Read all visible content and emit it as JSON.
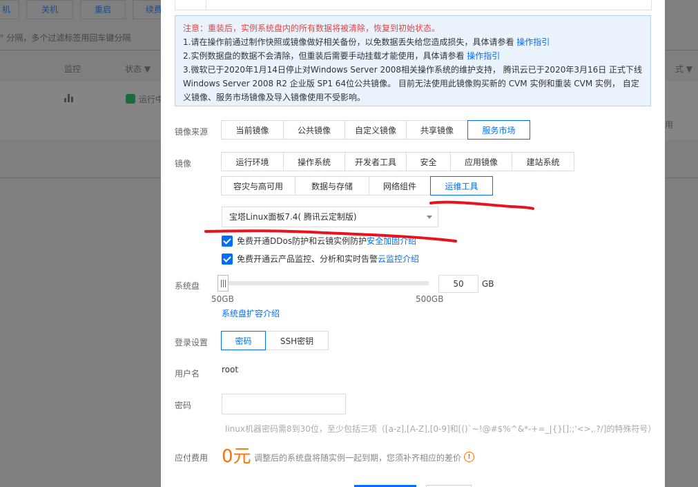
{
  "background": {
    "toolbar_buttons": [
      "机",
      "关机",
      "重启",
      "续费"
    ],
    "filter_hint": "\" 分隔，多个过滤标签用回车键分隔",
    "columns": {
      "monitor": "监控",
      "status": "状态",
      "right": "式"
    },
    "row": {
      "status_text": "运行中",
      "right_text": "用"
    }
  },
  "notice": {
    "warning": "注意：重装后，实例系统盘内的所有数据将被清除，恢复到初始状态。",
    "line1": "1.请在操作前通过制作快照或镜像做好相关备份，以免数据丢失给您造成损失，具体请参看 ",
    "line1_link": "操作指引",
    "line2": "2.实例数据盘的数据不会清除，但重装后需要手动挂载才能使用，具体请参看 ",
    "line2_link": "操作指引",
    "line3": "3.微软已于2020年1月14日停止对Windows Server 2008相关操作系统的维护支持， 腾讯云已于2020年3月16日 正式下线Windows Server 2008 R2 企业版 SP1 64位公共镜像。 目前无法使用此镜像购买新的 CVM 实例和重装 CVM 实例， 自定义镜像、服务市场镜像及导入镜像使用不受影响。"
  },
  "image_source": {
    "label": "镜像来源",
    "tabs": [
      "当前镜像",
      "公共镜像",
      "自定义镜像",
      "共享镜像",
      "服务市场"
    ],
    "active": "服务市场"
  },
  "image": {
    "label": "镜像",
    "row1": [
      "运行环境",
      "操作系统",
      "开发者工具",
      "安全",
      "应用镜像",
      "建站系统"
    ],
    "row2": [
      "容灾与高可用",
      "数据与存储",
      "网络组件",
      "运维工具"
    ],
    "active": "运维工具",
    "selected": "宝塔Linux面板7.4( 腾讯云定制版)"
  },
  "checks": {
    "ddos_text": "免费开通DDos防护和云镜实例防护 ",
    "ddos_link": "安全加固介绍",
    "monitor_text": "免费开通云产品监控、分析和实时告警 ",
    "monitor_link": "云监控介绍"
  },
  "system_disk": {
    "label": "系统盘",
    "value": "50",
    "unit": "GB",
    "min": "50GB",
    "max": "500GB",
    "link": "系统盘扩容介绍"
  },
  "login": {
    "label": "登录设置",
    "tabs": [
      "密码",
      "SSH密钥"
    ],
    "active": "密码"
  },
  "username": {
    "label": "用户名",
    "value": "root"
  },
  "password": {
    "label": "密码",
    "hint": "linux机器密码需8到30位，至少包括三项（[a-z],[A-Z],[0-9]和[()`~!@#$%^&*-+=_|{}[]:;'<>,.?/]的特殊符号）"
  },
  "fee": {
    "label": "应付费用",
    "amount": "0元",
    "note": "调整后的系统盘将随实例一起到期，您须补齐相应的差价"
  },
  "colors": {
    "accent": "#006eff",
    "warning": "#e54545",
    "price": "#ff7200",
    "annotation": "#e8131f"
  }
}
